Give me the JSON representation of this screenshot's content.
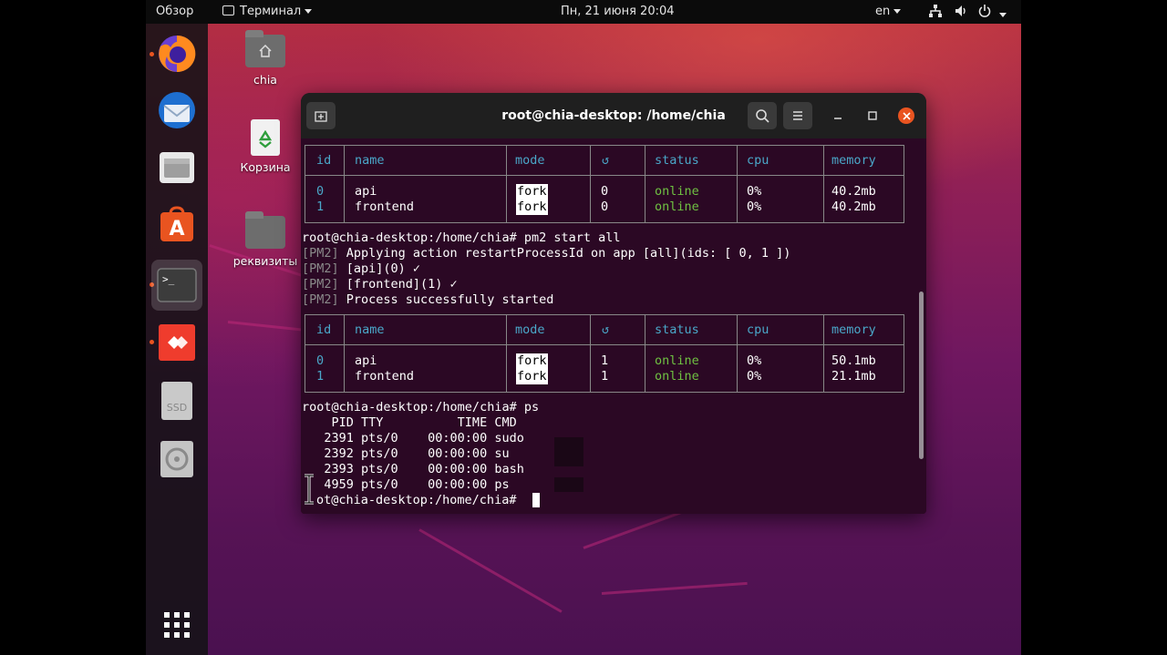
{
  "topbar": {
    "overview": "Обзор",
    "app_name": "Терминал",
    "datetime": "Пн, 21 июня  20:04",
    "lang": "en"
  },
  "desktop": {
    "icons": [
      {
        "label": "chia"
      },
      {
        "label": "Корзина"
      },
      {
        "label": "реквизиты"
      }
    ]
  },
  "dock": {
    "items": [
      "firefox-icon",
      "thunderbird-icon",
      "files-icon",
      "software-icon",
      "terminal-icon",
      "anydesk-icon",
      "ssd-drive-icon",
      "disc-icon"
    ],
    "ssd_label": "SSD"
  },
  "terminal": {
    "title": "root@chia-desktop: /home/chia",
    "table_headers": [
      "id",
      "name",
      "mode",
      "↺",
      "status",
      "cpu",
      "memory"
    ],
    "table1": [
      {
        "id": "0",
        "name": "api",
        "mode": "fork",
        "restarts": "0",
        "status": "online",
        "cpu": "0%",
        "memory": "40.2mb"
      },
      {
        "id": "1",
        "name": "frontend",
        "mode": "fork",
        "restarts": "0",
        "status": "online",
        "cpu": "0%",
        "memory": "40.2mb"
      }
    ],
    "table2": [
      {
        "id": "0",
        "name": "api",
        "mode": "fork",
        "restarts": "1",
        "status": "online",
        "cpu": "0%",
        "memory": "50.1mb"
      },
      {
        "id": "1",
        "name": "frontend",
        "mode": "fork",
        "restarts": "1",
        "status": "online",
        "cpu": "0%",
        "memory": "21.1mb"
      }
    ],
    "prompt": "root@chia-desktop:/home/chia#",
    "cmd1": " pm2 start all",
    "pm2_tag": "[PM2]",
    "pm2_lines": [
      " Applying action restartProcessId on app [all](ids: [ 0, 1 ])",
      " [api](0) ✓",
      " [frontend](1) ✓",
      " Process successfully started"
    ],
    "cmd2": " ps",
    "ps_header": "    PID TTY          TIME CMD",
    "ps_rows": [
      "   2391 pts/0    00:00:00 sudo",
      "   2392 pts/0    00:00:00 su",
      "   2393 pts/0    00:00:00 bash",
      "   4959 pts/0    00:00:00 ps"
    ],
    "last_prompt": "ot@chia-desktop:/home/chia#"
  }
}
